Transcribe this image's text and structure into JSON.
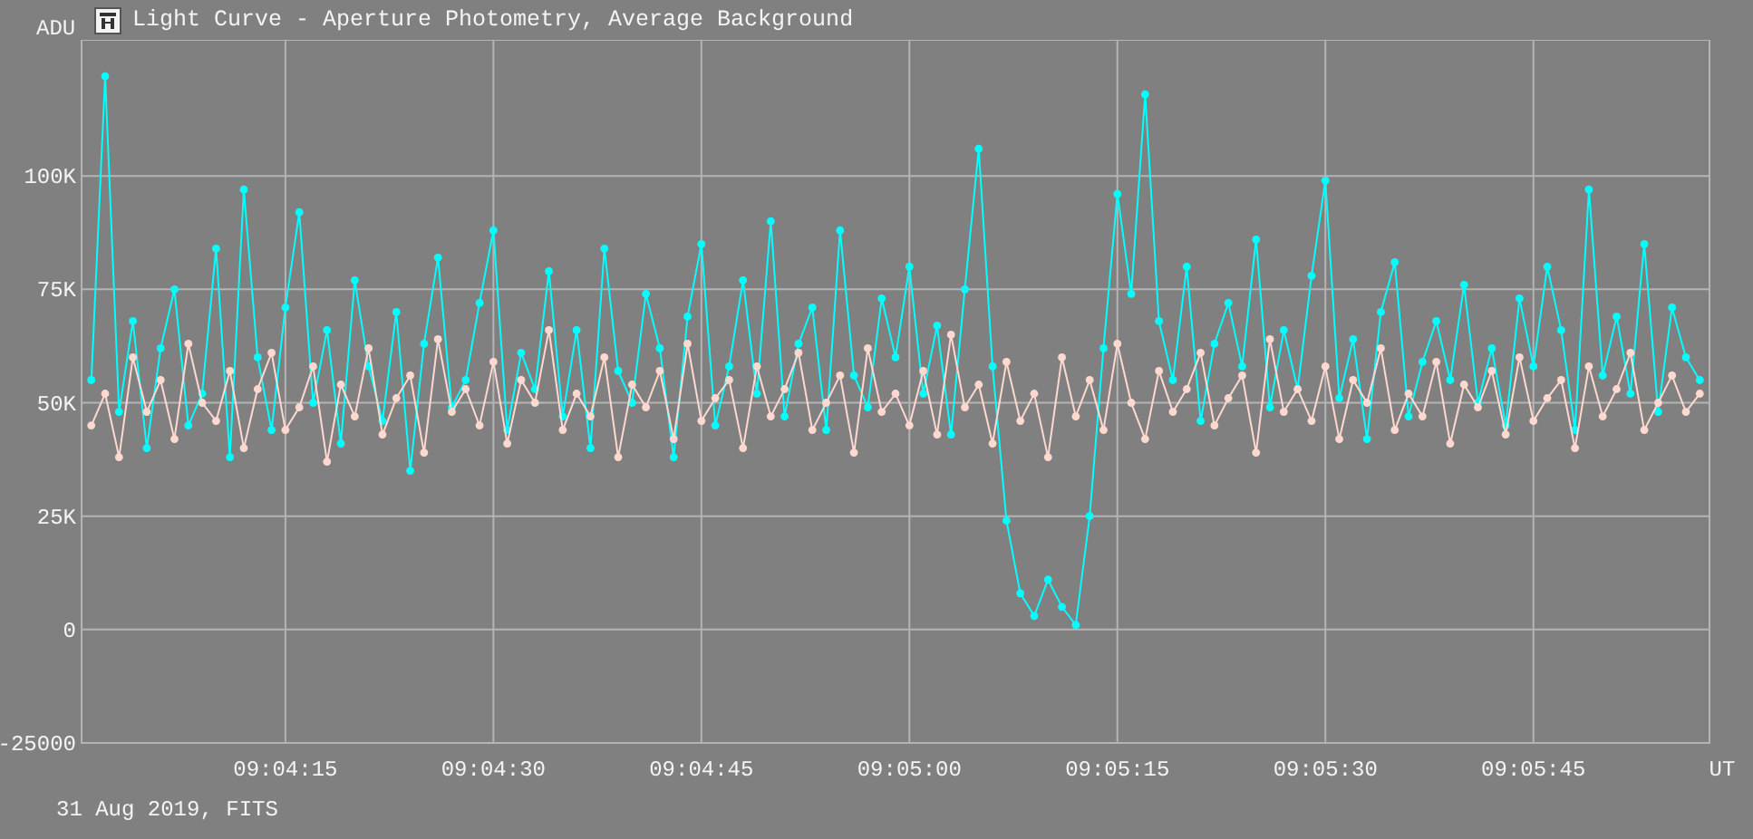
{
  "window": {
    "title": "Light Curve - Aperture Photometry, Average Background"
  },
  "chart_data": {
    "type": "line",
    "xlabel": "UT",
    "ylabel": "ADU",
    "grid": true,
    "xlim": [
      32640.3,
      32757.7
    ],
    "ylim": [
      -25000,
      130000
    ],
    "x": [
      32641,
      32642,
      32643,
      32644,
      32645,
      32646,
      32647,
      32648,
      32649,
      32650,
      32651,
      32652,
      32653,
      32654,
      32655,
      32656,
      32657,
      32658,
      32659,
      32660,
      32661,
      32662,
      32663,
      32664,
      32665,
      32666,
      32667,
      32668,
      32669,
      32670,
      32671,
      32672,
      32673,
      32674,
      32675,
      32676,
      32677,
      32678,
      32679,
      32680,
      32681,
      32682,
      32683,
      32684,
      32685,
      32686,
      32687,
      32688,
      32689,
      32690,
      32691,
      32692,
      32693,
      32694,
      32695,
      32696,
      32697,
      32698,
      32699,
      32700,
      32701,
      32702,
      32703,
      32704,
      32705,
      32706,
      32707,
      32708,
      32709,
      32710,
      32711,
      32712,
      32713,
      32714,
      32715,
      32716,
      32717,
      32718,
      32719,
      32720,
      32721,
      32722,
      32723,
      32724,
      32725,
      32726,
      32727,
      32728,
      32729,
      32730,
      32731,
      32732,
      32733,
      32734,
      32735,
      32736,
      32737,
      32738,
      32739,
      32740,
      32741,
      32742,
      32743,
      32744,
      32745,
      32746,
      32747,
      32748,
      32749,
      32750,
      32751,
      32752,
      32753,
      32754,
      32755,
      32756,
      32757
    ],
    "xticks": [
      {
        "value": 32655,
        "label": "09:04:15"
      },
      {
        "value": 32670,
        "label": "09:04:30"
      },
      {
        "value": 32685,
        "label": "09:04:45"
      },
      {
        "value": 32700,
        "label": "09:05:00"
      },
      {
        "value": 32715,
        "label": "09:05:15"
      },
      {
        "value": 32730,
        "label": "09:05:30"
      },
      {
        "value": 32745,
        "label": "09:05:45"
      }
    ],
    "yticks": [
      {
        "value": 100000,
        "label": "100K"
      },
      {
        "value": 75000,
        "label": "75K"
      },
      {
        "value": 50000,
        "label": "50K"
      },
      {
        "value": 25000,
        "label": "25K"
      },
      0,
      -25000
    ],
    "series": [
      {
        "color": "#00ffff",
        "marker": "circle",
        "values": [
          55000,
          122000,
          48000,
          68000,
          40000,
          62000,
          75000,
          45000,
          52000,
          84000,
          38000,
          97000,
          60000,
          44000,
          71000,
          92000,
          50000,
          66000,
          41000,
          77000,
          58000,
          46000,
          70000,
          35000,
          63000,
          82000,
          49000,
          55000,
          72000,
          88000,
          44000,
          61000,
          53000,
          79000,
          47000,
          66000,
          40000,
          84000,
          57000,
          50000,
          74000,
          62000,
          38000,
          69000,
          85000,
          45000,
          58000,
          77000,
          52000,
          90000,
          47000,
          63000,
          71000,
          44000,
          88000,
          56000,
          49000,
          73000,
          60000,
          80000,
          52000,
          67000,
          43000,
          75000,
          106000,
          58000,
          24000,
          8000,
          3000,
          11000,
          5000,
          1000,
          25000,
          62000,
          96000,
          74000,
          118000,
          68000,
          55000,
          80000,
          46000,
          63000,
          72000,
          58000,
          86000,
          49000,
          66000,
          53000,
          78000,
          99000,
          51000,
          64000,
          42000,
          70000,
          81000,
          47000,
          59000,
          68000,
          55000,
          76000,
          50000,
          62000,
          45000,
          73000,
          58000,
          80000,
          66000,
          44000,
          97000,
          56000,
          69000,
          52000,
          85000,
          48000,
          71000,
          60000,
          55000
        ]
      },
      {
        "color": "#ffd8d0",
        "marker": "circle",
        "values": [
          45000,
          52000,
          38000,
          60000,
          48000,
          55000,
          42000,
          63000,
          50000,
          46000,
          57000,
          40000,
          53000,
          61000,
          44000,
          49000,
          58000,
          37000,
          54000,
          47000,
          62000,
          43000,
          51000,
          56000,
          39000,
          64000,
          48000,
          53000,
          45000,
          59000,
          41000,
          55000,
          50000,
          66000,
          44000,
          52000,
          47000,
          60000,
          38000,
          54000,
          49000,
          57000,
          42000,
          63000,
          46000,
          51000,
          55000,
          40000,
          58000,
          47000,
          53000,
          61000,
          44000,
          50000,
          56000,
          39000,
          62000,
          48000,
          52000,
          45000,
          57000,
          43000,
          65000,
          49000,
          54000,
          41000,
          59000,
          46000,
          52000,
          38000,
          60000,
          47000,
          55000,
          44000,
          63000,
          50000,
          42000,
          57000,
          48000,
          53000,
          61000,
          45000,
          51000,
          56000,
          39000,
          64000,
          48000,
          53000,
          46000,
          58000,
          42000,
          55000,
          50000,
          62000,
          44000,
          52000,
          47000,
          59000,
          41000,
          54000,
          49000,
          57000,
          43000,
          60000,
          46000,
          51000,
          55000,
          40000,
          58000,
          47000,
          53000,
          61000,
          44000,
          50000,
          56000,
          48000,
          52000
        ]
      }
    ]
  },
  "footer": "31 Aug 2019, FITS"
}
